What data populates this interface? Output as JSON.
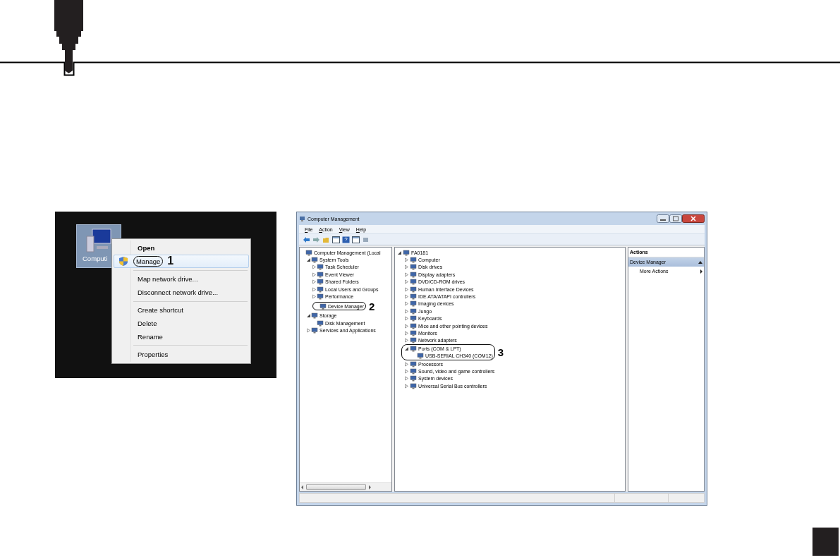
{
  "context_menu_screenshot": {
    "desktop_icon_label": "Computi",
    "menu_items": [
      {
        "label": "Open",
        "kind": "plain",
        "default": true,
        "selected": false,
        "separator_before": false
      },
      {
        "label": "Manage",
        "kind": "shield",
        "default": false,
        "selected": true,
        "separator_before": false,
        "callout": "1"
      },
      {
        "label": "Map network drive...",
        "kind": "plain",
        "default": false,
        "selected": false,
        "separator_before": true
      },
      {
        "label": "Disconnect network drive...",
        "kind": "plain",
        "default": false,
        "selected": false,
        "separator_before": false
      },
      {
        "label": "Create shortcut",
        "kind": "plain",
        "default": false,
        "selected": false,
        "separator_before": true
      },
      {
        "label": "Delete",
        "kind": "plain",
        "default": false,
        "selected": false,
        "separator_before": false
      },
      {
        "label": "Rename",
        "kind": "plain",
        "default": false,
        "selected": false,
        "separator_before": false
      },
      {
        "label": "Properties",
        "kind": "plain",
        "default": false,
        "selected": false,
        "separator_before": true
      }
    ]
  },
  "window": {
    "title": "Computer Management",
    "menu": [
      "File",
      "Action",
      "View",
      "Help"
    ],
    "left_tree": [
      {
        "label": "Computer Management (Local",
        "children": [
          {
            "label": "System Tools",
            "expanded": true,
            "children": [
              {
                "label": "Task Scheduler",
                "expanded": false
              },
              {
                "label": "Event Viewer",
                "expanded": false
              },
              {
                "label": "Shared Folders",
                "expanded": false
              },
              {
                "label": "Local Users and Groups",
                "expanded": false
              },
              {
                "label": "Performance",
                "expanded": false
              },
              {
                "label": "Device Manager",
                "callout": "2"
              }
            ]
          },
          {
            "label": "Storage",
            "expanded": true,
            "children": [
              {
                "label": "Disk Management"
              }
            ]
          },
          {
            "label": "Services and Applications",
            "expanded": false
          }
        ]
      }
    ],
    "device_tree": [
      {
        "label": "FA0181",
        "expanded": true,
        "children": [
          {
            "label": "Computer",
            "expanded": false
          },
          {
            "label": "Disk drives",
            "expanded": false
          },
          {
            "label": "Display adapters",
            "expanded": false
          },
          {
            "label": "DVD/CD-ROM drives",
            "expanded": false
          },
          {
            "label": "Human Interface Devices",
            "expanded": false
          },
          {
            "label": "IDE ATA/ATAPI controllers",
            "expanded": false
          },
          {
            "label": "Imaging devices",
            "expanded": false
          },
          {
            "label": "Jungo",
            "expanded": false
          },
          {
            "label": "Keyboards",
            "expanded": false
          },
          {
            "label": "Mice and other pointing devices",
            "expanded": false
          },
          {
            "label": "Monitors",
            "expanded": false
          },
          {
            "label": "Network adapters",
            "expanded": false
          },
          {
            "label": "Ports (COM & LPT)",
            "expanded": true,
            "callout": "3",
            "children": [
              {
                "label": "USB-SERIAL CH340 (COM12)"
              }
            ]
          },
          {
            "label": "Processors",
            "expanded": false
          },
          {
            "label": "Sound, video and game controllers",
            "expanded": false
          },
          {
            "label": "System devices",
            "expanded": false
          },
          {
            "label": "Universal Serial Bus controllers",
            "expanded": false
          }
        ]
      }
    ],
    "actions": {
      "header": "Actions",
      "section": "Device Manager",
      "items": [
        "More Actions"
      ]
    }
  }
}
